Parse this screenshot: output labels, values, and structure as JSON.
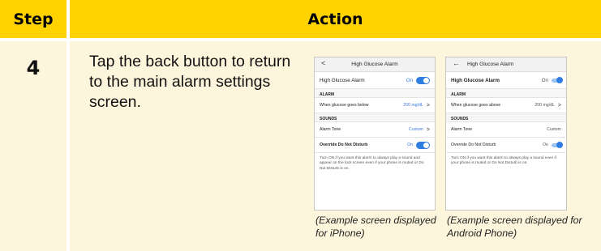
{
  "header": {
    "step": "Step",
    "action": "Action"
  },
  "row": {
    "step_number": "4",
    "instruction": "Tap the back button to return to the main alarm settings screen."
  },
  "iphone": {
    "back": "<",
    "title": "High Glucose Alarm",
    "alarm_label": "High Glucose Alarm",
    "alarm_state": "On",
    "section_alarm": "ALARM",
    "glucose_label": "When glucose goes below",
    "glucose_value": "200 mg/dL",
    "section_sounds": "SOUNDS",
    "tone_label": "Alarm Tone",
    "tone_value": "Custom",
    "override_label": "Override Do Not Disturb",
    "override_state": "On",
    "note": "Turn ON if you want this alarm to always play a sound and appear on the lock screen even if your phone is muted or Do Not Disturb is on.",
    "caption": "(Example screen displayed for iPhone)"
  },
  "android": {
    "back": "←",
    "title": "High Glucose Alarm",
    "alarm_label": "High Glucose Alarm",
    "alarm_state": "On",
    "section_alarm": "ALARM",
    "glucose_label": "When glucose goes above",
    "glucose_value": "200 mg/dL",
    "section_sounds": "SOUNDS",
    "tone_label": "Alarm Tone",
    "tone_value": "Custom",
    "override_label": "Override Do Not Disturb",
    "override_state": "On",
    "note": "Turn ON if you want this alarm to always play a sound even if your phone is muted or Do Not Disturb is on.",
    "caption": "(Example screen displayed for Android Phone)"
  },
  "colors": {
    "header_bg": "#ffd200",
    "cell_bg": "#fdf6dc",
    "toggle_blue": "#2f7de1"
  }
}
